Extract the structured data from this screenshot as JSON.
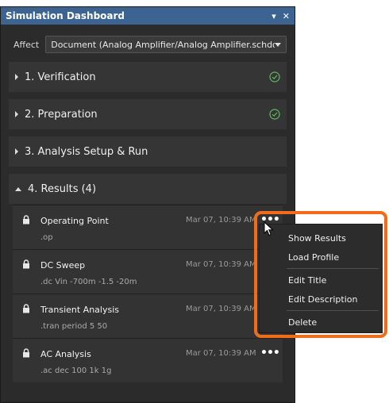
{
  "panel": {
    "title": "Simulation Dashboard"
  },
  "titlebar": {
    "icons": [
      "pin-icon",
      "close-icon"
    ]
  },
  "affect": {
    "label": "Affect",
    "value": "Document (Analog Amplifier/Analog Amplifier.schdoc)"
  },
  "sections": [
    {
      "label": "1. Verification",
      "status": "complete"
    },
    {
      "label": "2. Preparation",
      "status": "complete"
    },
    {
      "label": "3. Analysis Setup & Run",
      "status": ""
    },
    {
      "label": "4. Results (4)",
      "status": "expanded"
    }
  ],
  "results": [
    {
      "name": "Operating Point",
      "command": ".op",
      "date": "Mar 07, 10:39 AM"
    },
    {
      "name": "DC Sweep",
      "command": ".dc Vin -700m -1.5 -20m",
      "date": "Mar 07, 10:39 AM"
    },
    {
      "name": "Transient Analysis",
      "command": ".tran period 5 50",
      "date": "Mar 07, 10:39 AM"
    },
    {
      "name": "AC Analysis",
      "command": ".ac dec 100 1k 1g",
      "date": "Mar 07, 10:39 AM"
    }
  ],
  "context_menu": {
    "items": [
      "Show Results",
      "Load Profile",
      "Edit Title",
      "Edit Description",
      "Delete"
    ]
  },
  "colors": {
    "titlebar": "#3d6490",
    "highlight": "#ef6c1a",
    "check": "#5fb85f"
  }
}
